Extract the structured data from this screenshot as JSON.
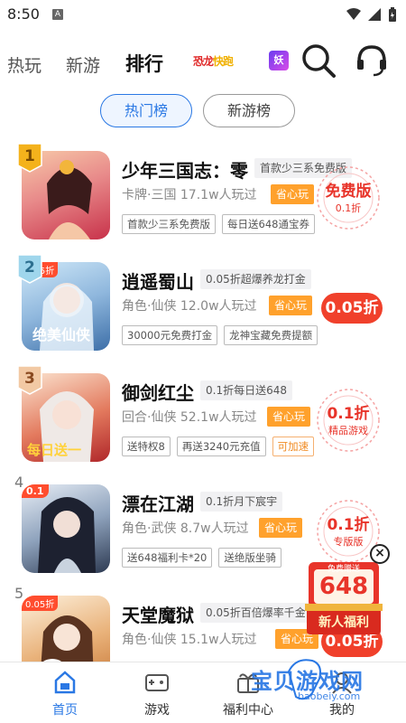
{
  "status": {
    "time": "8:50",
    "notif_icon": "A"
  },
  "topnav": {
    "tabs": [
      {
        "label": "热玩",
        "active": false
      },
      {
        "label": "新游",
        "active": false
      },
      {
        "label": "排行",
        "active": true
      }
    ],
    "logo1": {
      "a": "恐龙",
      "b": "快跑"
    },
    "logo2": "妖"
  },
  "rank_tabs": {
    "hot": "热门榜",
    "new": "新游榜"
  },
  "games": [
    {
      "rank": "1",
      "title": "少年三国志：零",
      "promo": "首款少三系免费版",
      "meta": "卡牌·三国  17.1w人玩过",
      "save": "省心玩",
      "tags": [
        "首款少三系免费版",
        "每日送648通宝券"
      ],
      "badge": {
        "type": "seal",
        "main": "免费版",
        "sub": "0.1折"
      },
      "thumb_colors": [
        "#f7c9a8",
        "#c8324a"
      ]
    },
    {
      "rank": "2",
      "title": "逍遥蜀山",
      "promo": "0.05折超爆养龙打金",
      "meta": "角色·仙侠  12.0w人玩过",
      "save": "省心玩",
      "tags": [
        "30000元免费打金",
        "龙神宝藏免费提额"
      ],
      "badge": {
        "type": "button",
        "main": "0.05折"
      },
      "thumb_corner": "0.05折",
      "thumb_colors": [
        "#a9d4f0",
        "#3d6fa8"
      ]
    },
    {
      "rank": "3",
      "title": "御剑红尘",
      "promo": "0.1折每日送648",
      "meta": "回合·仙侠  52.1w人玩过",
      "save": "省心玩",
      "tags": [
        "送特权8",
        "再送3240元充值",
        "可加速"
      ],
      "badge": {
        "type": "seal",
        "main": "0.1折",
        "sub": "精品游戏"
      },
      "thumb_colors": [
        "#f4d6c0",
        "#b0272a"
      ]
    },
    {
      "rank": "4",
      "title": "漂在江湖",
      "promo": "0.1折月下宸宇",
      "meta": "角色·武侠  8.7w人玩过",
      "save": "省心玩",
      "tags": [
        "送648福利卡*20",
        "送绝版坐骑"
      ],
      "badge": {
        "type": "seal",
        "main": "0.1折",
        "sub": "专版版"
      },
      "thumb_corner": "0.1",
      "thumb_colors": [
        "#c9d6e4",
        "#2d3a52"
      ]
    },
    {
      "rank": "5",
      "title": "天堂魔狱",
      "promo": "0.05折百倍爆率千金",
      "meta": "角色·仙侠  15.1w人玩过",
      "save": "省心玩",
      "tags": [],
      "badge": {
        "type": "button",
        "main": "0.05折"
      },
      "thumb_corner": "0.05折",
      "thumb_colors": [
        "#f5e1c8",
        "#c97a3a"
      ]
    }
  ],
  "float_gift": {
    "top": "免费赠送",
    "amount": "648",
    "label": "新人福利"
  },
  "bottom_nav": [
    {
      "label": "首页",
      "active": true
    },
    {
      "label": "游戏",
      "active": false
    },
    {
      "label": "福利中心",
      "active": false
    },
    {
      "label": "我的",
      "active": false
    }
  ],
  "watermark": {
    "text": "宝贝游戏网",
    "url": "baobeiy.com"
  },
  "colors": {
    "accent": "#2a78e4",
    "red": "#f0402b",
    "orange": "#ffa12c"
  }
}
